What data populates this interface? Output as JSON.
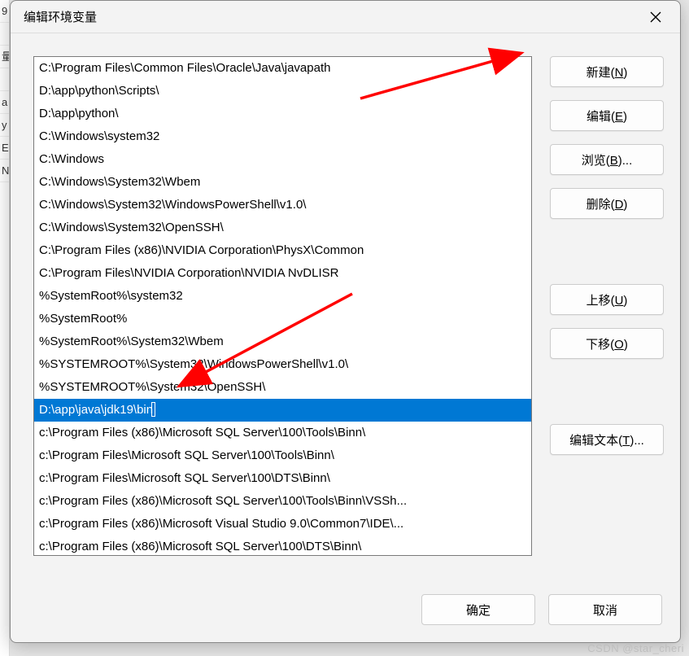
{
  "dialog": {
    "title": "编辑环境变量"
  },
  "list": {
    "items": [
      "C:\\Program Files\\Common Files\\Oracle\\Java\\javapath",
      "D:\\app\\python\\Scripts\\",
      "D:\\app\\python\\",
      "C:\\Windows\\system32",
      "C:\\Windows",
      "C:\\Windows\\System32\\Wbem",
      "C:\\Windows\\System32\\WindowsPowerShell\\v1.0\\",
      "C:\\Windows\\System32\\OpenSSH\\",
      "C:\\Program Files (x86)\\NVIDIA Corporation\\PhysX\\Common",
      "C:\\Program Files\\NVIDIA Corporation\\NVIDIA NvDLISR",
      "%SystemRoot%\\system32",
      "%SystemRoot%",
      "%SystemRoot%\\System32\\Wbem",
      "%SYSTEMROOT%\\System32\\WindowsPowerShell\\v1.0\\",
      "%SYSTEMROOT%\\System32\\OpenSSH\\",
      "D:\\app\\java\\jdk19\\bin",
      "c:\\Program Files (x86)\\Microsoft SQL Server\\100\\Tools\\Binn\\",
      "c:\\Program Files\\Microsoft SQL Server\\100\\Tools\\Binn\\",
      "c:\\Program Files\\Microsoft SQL Server\\100\\DTS\\Binn\\",
      "c:\\Program Files (x86)\\Microsoft SQL Server\\100\\Tools\\Binn\\VSSh...",
      "c:\\Program Files (x86)\\Microsoft Visual Studio 9.0\\Common7\\IDE\\...",
      "c:\\Program Files (x86)\\Microsoft SQL Server\\100\\DTS\\Binn\\"
    ],
    "selected_index": 15
  },
  "buttons": {
    "new": {
      "label": "新建",
      "accelerator": "N"
    },
    "edit": {
      "label": "编辑",
      "accelerator": "E"
    },
    "browse": {
      "label": "浏览",
      "accelerator": "B",
      "suffix": "..."
    },
    "delete": {
      "label": "删除",
      "accelerator": "D"
    },
    "move_up": {
      "label": "上移",
      "accelerator": "U"
    },
    "move_down": {
      "label": "下移",
      "accelerator": "O"
    },
    "edit_text": {
      "label": "编辑文本",
      "accelerator": "T",
      "suffix": "..."
    }
  },
  "footer": {
    "ok": "确定",
    "cancel": "取消"
  },
  "watermark": "CSDN @star_cheri",
  "annotation": {
    "color": "#ff0000"
  }
}
